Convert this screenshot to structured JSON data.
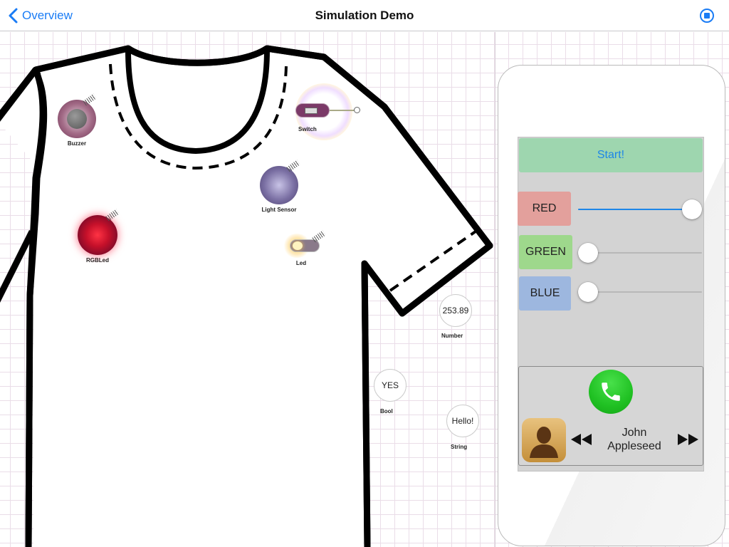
{
  "nav": {
    "back_label": "Overview",
    "title": "Simulation Demo"
  },
  "components": {
    "buzzer": "Buzzer",
    "switch": "Switch",
    "light_sensor": "Light Sensor",
    "rgbled": "RGBLed",
    "led": "Led"
  },
  "values": {
    "number": {
      "value": "253.89",
      "label": "Number"
    },
    "bool": {
      "value": "YES",
      "label": "Bool"
    },
    "string": {
      "value": "Hello!",
      "label": "String"
    }
  },
  "phone": {
    "start_label": "Start!",
    "sliders": [
      {
        "label": "RED",
        "color": "#e3a09c",
        "level": 1.0
      },
      {
        "label": "GREEN",
        "color": "#9ed88c",
        "level": 0.0
      },
      {
        "label": "BLUE",
        "color": "#9db7df",
        "level": 0.0
      }
    ],
    "contact_name": "John Appleseed"
  },
  "colors": {
    "accent": "#1a7cf5",
    "start_button": "#9ed6af",
    "call_green": "#20c123"
  },
  "icons": [
    "chevron-left-icon",
    "stop-icon",
    "phone-icon",
    "contact-icon",
    "rewind-icon",
    "fast-forward-icon"
  ]
}
